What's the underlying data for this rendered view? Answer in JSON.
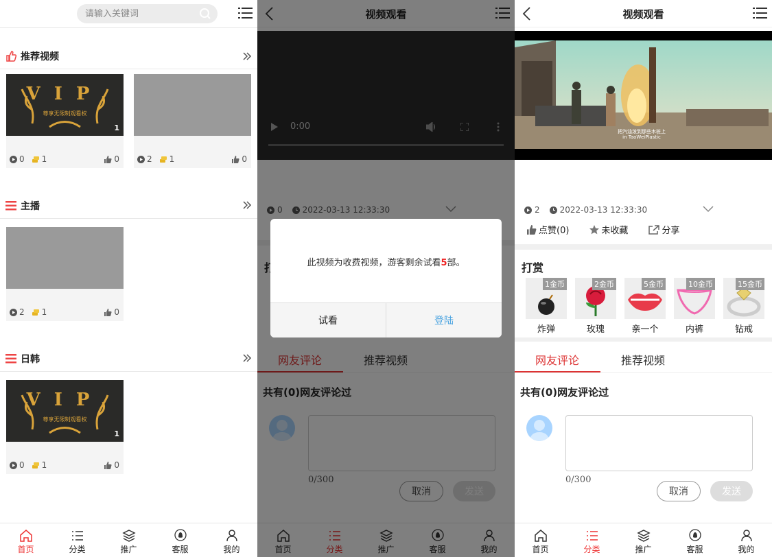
{
  "home": {
    "search_placeholder": "请输入关键词",
    "sections": [
      {
        "title": "推荐视频",
        "cards": [
          {
            "thumb": "vip",
            "vip_text": "VIP",
            "vip_sub": "尊享无限制观看权",
            "badge": "1",
            "plays": "0",
            "coins": "1",
            "likes": "0"
          },
          {
            "thumb": "grey",
            "plays": "2",
            "coins": "1",
            "likes": "0"
          }
        ]
      },
      {
        "title": "主播",
        "cards": [
          {
            "thumb": "grey",
            "plays": "2",
            "coins": "1",
            "likes": "0"
          }
        ]
      },
      {
        "title": "日韩",
        "cards": [
          {
            "thumb": "vip",
            "vip_text": "VIP",
            "vip_sub": "尊享无限制观看权",
            "badge": "1",
            "plays": "0",
            "coins": "1",
            "likes": "0"
          }
        ]
      }
    ]
  },
  "tabs": [
    "首页",
    "分类",
    "推广",
    "客服",
    "我的"
  ],
  "watch": {
    "title": "视频观看",
    "player_time": "0:00",
    "plays_trial": "0",
    "plays": "2",
    "datetime": "2022-03-13 12:33:30",
    "like_label": "点赞(0)",
    "fav_label": "未收藏",
    "share_label": "分享",
    "reward_title": "打赏",
    "reward_title_partial": "打",
    "gifts": [
      {
        "price": "1金币",
        "name": "炸弹"
      },
      {
        "price": "2金币",
        "name": "玫瑰"
      },
      {
        "price": "5金币",
        "name": "亲一个"
      },
      {
        "price": "10金币",
        "name": "内裤"
      },
      {
        "price": "15金币",
        "name": "钻戒"
      }
    ],
    "comment_tab": "网友评论",
    "recommend_tab": "推荐视频",
    "comment_count": "共有(0)网友评论过",
    "char_limit": "0/300",
    "cancel_label": "取消",
    "send_label": "发送",
    "subtitle_line1": "把汽油泼到那些木桩上",
    "subtitle_line2": "in TaoWeiPlastic"
  },
  "modal": {
    "msg_before": "此视频为收费视频，游客剩余试看",
    "msg_num": "5",
    "msg_after": "部。",
    "trial_label": "试看",
    "login_label": "登陆"
  },
  "colors": {
    "accent": "#dd3333",
    "link": "#4aa3e0",
    "mask": "rgba(0,0,0,0.5)"
  }
}
